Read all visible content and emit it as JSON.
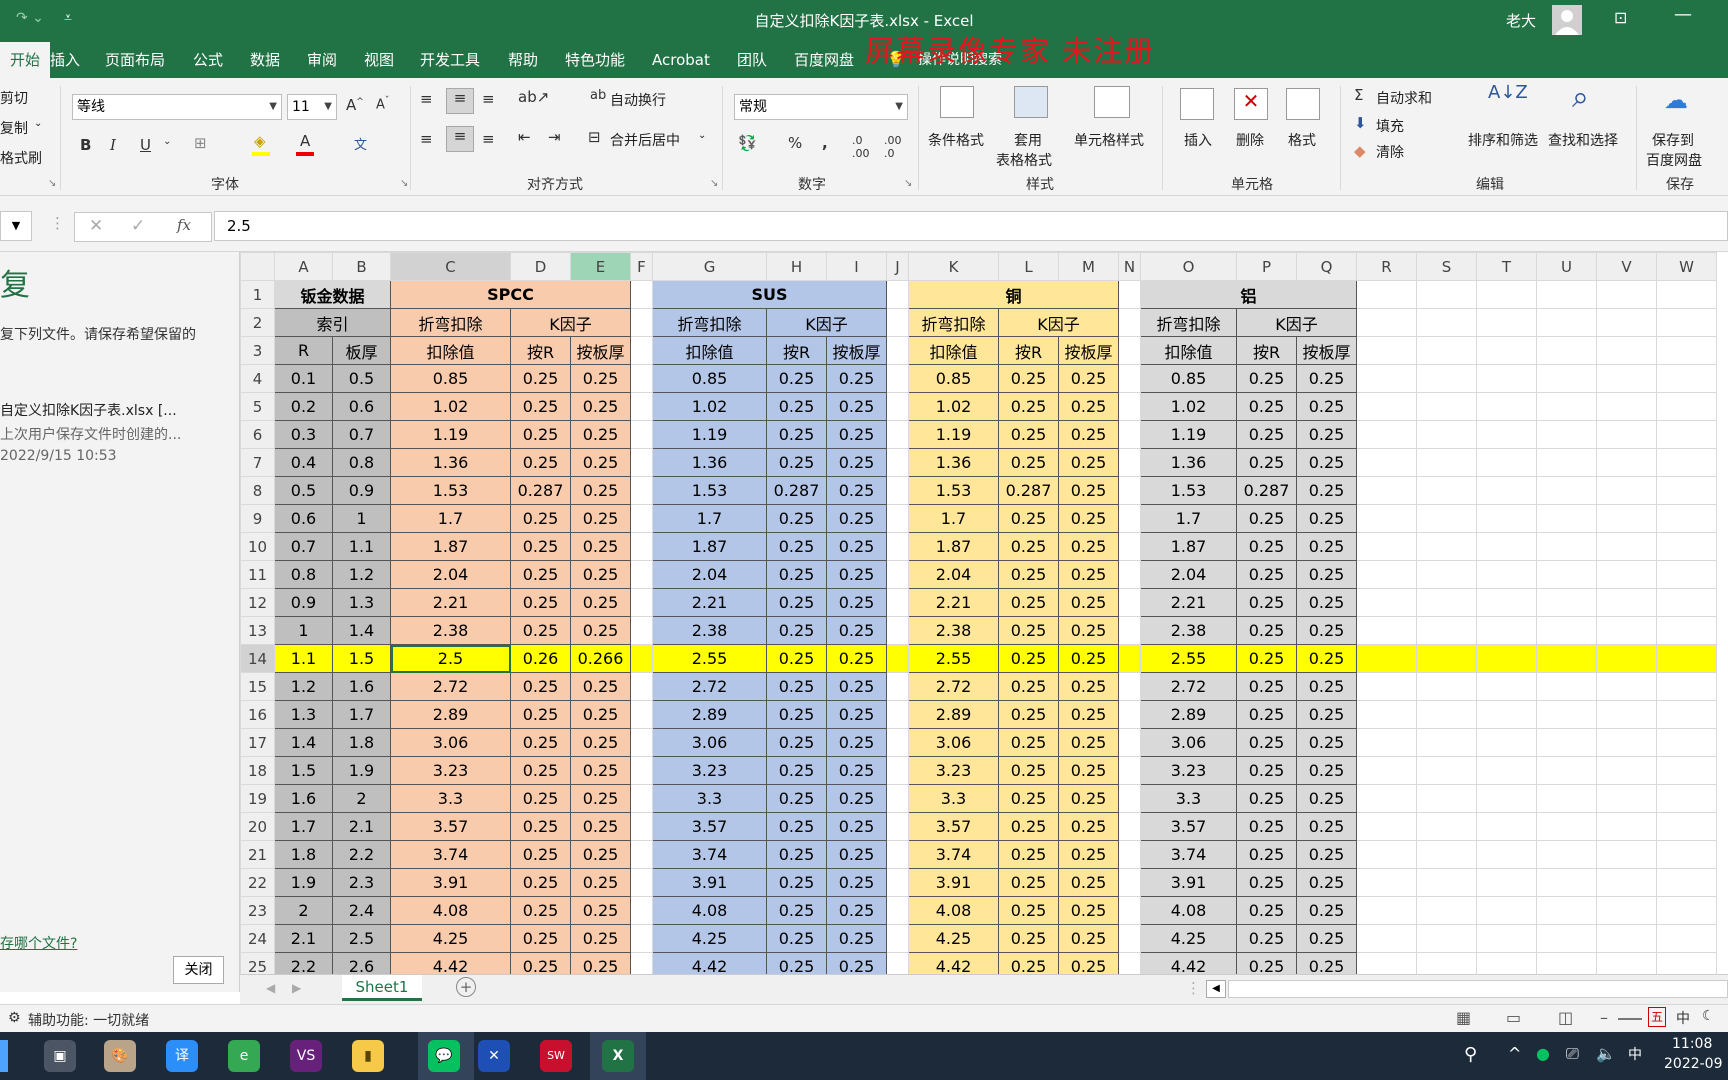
{
  "window": {
    "title": "自定义扣除K因子表.xlsx  -  Excel",
    "user": "老大"
  },
  "watermark": "屏幕录像专家  未注册",
  "menu": {
    "tabs": [
      "开始",
      "插入",
      "页面布局",
      "公式",
      "数据",
      "审阅",
      "视图",
      "开发工具",
      "帮助",
      "特色功能",
      "Acrobat",
      "团队",
      "百度网盘"
    ],
    "search": "操作说明搜索"
  },
  "ribbon": {
    "clipboard": {
      "cut": "剪切",
      "copy": "复制",
      "painter": "格式刷"
    },
    "font": {
      "name": "等线",
      "size": "11",
      "group": "字体"
    },
    "align": {
      "wrap": "自动换行",
      "merge": "合并后居中",
      "group": "对齐方式"
    },
    "number": {
      "format": "常规",
      "group": "数字"
    },
    "styles": {
      "cond": "条件格式",
      "table1": "套用",
      "table2": "表格格式",
      "cell": "单元格样式",
      "group": "样式"
    },
    "cells": {
      "insert": "插入",
      "delete": "删除",
      "format": "格式",
      "group": "单元格"
    },
    "edit": {
      "autosum": "自动求和",
      "fill": "填充",
      "clear": "清除",
      "sort": "排序和筛选",
      "find": "查找和选择",
      "group": "编辑"
    },
    "save": {
      "l1": "保存到",
      "l2": "百度网盘",
      "group": "保存"
    }
  },
  "formula": {
    "fx": "fx",
    "value": "2.5"
  },
  "pane": {
    "title": "复",
    "desc": "复下列文件。请保存希望保留的",
    "file": "自定义扣除K因子表.xlsx  [...",
    "note": "上次用户保存文件时创建的...",
    "date": "2022/9/15 10:53",
    "link": "存哪个文件?",
    "close": "关闭"
  },
  "colors": {
    "excel_green": "#217346",
    "spcc": "#f8cbad",
    "sus": "#b4c6e7",
    "copper": "#ffe699",
    "alu": "#d9d9d9",
    "index": "#bfbfbf",
    "highlight": "#ffff00"
  },
  "sheet": {
    "columns": [
      "A",
      "B",
      "C",
      "D",
      "E",
      "F",
      "G",
      "H",
      "I",
      "J",
      "K",
      "L",
      "M",
      "N",
      "O",
      "P",
      "Q",
      "R",
      "S",
      "T",
      "U",
      "V",
      "W"
    ],
    "headers": {
      "r1": [
        "钣金数据",
        "SPCC",
        "SUS",
        "铜",
        "铝"
      ],
      "r2": [
        "索引",
        "折弯扣除",
        "K因子",
        "折弯扣除",
        "K因子",
        "折弯扣除",
        "K因子",
        "折弯扣除",
        "K因子"
      ],
      "r3": [
        "R",
        "板厚",
        "扣除值",
        "按R",
        "按板厚",
        "扣除值",
        "按R",
        "按板厚",
        "扣除值",
        "按R",
        "按板厚",
        "扣除值",
        "按R",
        "按板厚"
      ]
    },
    "selected_row": 14,
    "rows": [
      {
        "n": 4,
        "r": "0.1",
        "t": "0.5",
        "c": [
          "0.85",
          "0.25",
          "0.25",
          "0.85",
          "0.25",
          "0.25",
          "0.85",
          "0.25",
          "0.25",
          "0.85",
          "0.25",
          "0.25"
        ]
      },
      {
        "n": 5,
        "r": "0.2",
        "t": "0.6",
        "c": [
          "1.02",
          "0.25",
          "0.25",
          "1.02",
          "0.25",
          "0.25",
          "1.02",
          "0.25",
          "0.25",
          "1.02",
          "0.25",
          "0.25"
        ]
      },
      {
        "n": 6,
        "r": "0.3",
        "t": "0.7",
        "c": [
          "1.19",
          "0.25",
          "0.25",
          "1.19",
          "0.25",
          "0.25",
          "1.19",
          "0.25",
          "0.25",
          "1.19",
          "0.25",
          "0.25"
        ]
      },
      {
        "n": 7,
        "r": "0.4",
        "t": "0.8",
        "c": [
          "1.36",
          "0.25",
          "0.25",
          "1.36",
          "0.25",
          "0.25",
          "1.36",
          "0.25",
          "0.25",
          "1.36",
          "0.25",
          "0.25"
        ]
      },
      {
        "n": 8,
        "r": "0.5",
        "t": "0.9",
        "c": [
          "1.53",
          "0.287",
          "0.25",
          "1.53",
          "0.287",
          "0.25",
          "1.53",
          "0.287",
          "0.25",
          "1.53",
          "0.287",
          "0.25"
        ]
      },
      {
        "n": 9,
        "r": "0.6",
        "t": "1",
        "c": [
          "1.7",
          "0.25",
          "0.25",
          "1.7",
          "0.25",
          "0.25",
          "1.7",
          "0.25",
          "0.25",
          "1.7",
          "0.25",
          "0.25"
        ]
      },
      {
        "n": 10,
        "r": "0.7",
        "t": "1.1",
        "c": [
          "1.87",
          "0.25",
          "0.25",
          "1.87",
          "0.25",
          "0.25",
          "1.87",
          "0.25",
          "0.25",
          "1.87",
          "0.25",
          "0.25"
        ]
      },
      {
        "n": 11,
        "r": "0.8",
        "t": "1.2",
        "c": [
          "2.04",
          "0.25",
          "0.25",
          "2.04",
          "0.25",
          "0.25",
          "2.04",
          "0.25",
          "0.25",
          "2.04",
          "0.25",
          "0.25"
        ]
      },
      {
        "n": 12,
        "r": "0.9",
        "t": "1.3",
        "c": [
          "2.21",
          "0.25",
          "0.25",
          "2.21",
          "0.25",
          "0.25",
          "2.21",
          "0.25",
          "0.25",
          "2.21",
          "0.25",
          "0.25"
        ]
      },
      {
        "n": 13,
        "r": "1",
        "t": "1.4",
        "c": [
          "2.38",
          "0.25",
          "0.25",
          "2.38",
          "0.25",
          "0.25",
          "2.38",
          "0.25",
          "0.25",
          "2.38",
          "0.25",
          "0.25"
        ]
      },
      {
        "n": 14,
        "r": "1.1",
        "t": "1.5",
        "c": [
          "2.5",
          "0.26",
          "0.266",
          "2.55",
          "0.25",
          "0.25",
          "2.55",
          "0.25",
          "0.25",
          "2.55",
          "0.25",
          "0.25"
        ]
      },
      {
        "n": 15,
        "r": "1.2",
        "t": "1.6",
        "c": [
          "2.72",
          "0.25",
          "0.25",
          "2.72",
          "0.25",
          "0.25",
          "2.72",
          "0.25",
          "0.25",
          "2.72",
          "0.25",
          "0.25"
        ]
      },
      {
        "n": 16,
        "r": "1.3",
        "t": "1.7",
        "c": [
          "2.89",
          "0.25",
          "0.25",
          "2.89",
          "0.25",
          "0.25",
          "2.89",
          "0.25",
          "0.25",
          "2.89",
          "0.25",
          "0.25"
        ]
      },
      {
        "n": 17,
        "r": "1.4",
        "t": "1.8",
        "c": [
          "3.06",
          "0.25",
          "0.25",
          "3.06",
          "0.25",
          "0.25",
          "3.06",
          "0.25",
          "0.25",
          "3.06",
          "0.25",
          "0.25"
        ]
      },
      {
        "n": 18,
        "r": "1.5",
        "t": "1.9",
        "c": [
          "3.23",
          "0.25",
          "0.25",
          "3.23",
          "0.25",
          "0.25",
          "3.23",
          "0.25",
          "0.25",
          "3.23",
          "0.25",
          "0.25"
        ]
      },
      {
        "n": 19,
        "r": "1.6",
        "t": "2",
        "c": [
          "3.3",
          "0.25",
          "0.25",
          "3.3",
          "0.25",
          "0.25",
          "3.3",
          "0.25",
          "0.25",
          "3.3",
          "0.25",
          "0.25"
        ]
      },
      {
        "n": 20,
        "r": "1.7",
        "t": "2.1",
        "c": [
          "3.57",
          "0.25",
          "0.25",
          "3.57",
          "0.25",
          "0.25",
          "3.57",
          "0.25",
          "0.25",
          "3.57",
          "0.25",
          "0.25"
        ]
      },
      {
        "n": 21,
        "r": "1.8",
        "t": "2.2",
        "c": [
          "3.74",
          "0.25",
          "0.25",
          "3.74",
          "0.25",
          "0.25",
          "3.74",
          "0.25",
          "0.25",
          "3.74",
          "0.25",
          "0.25"
        ]
      },
      {
        "n": 22,
        "r": "1.9",
        "t": "2.3",
        "c": [
          "3.91",
          "0.25",
          "0.25",
          "3.91",
          "0.25",
          "0.25",
          "3.91",
          "0.25",
          "0.25",
          "3.91",
          "0.25",
          "0.25"
        ]
      },
      {
        "n": 23,
        "r": "2",
        "t": "2.4",
        "c": [
          "4.08",
          "0.25",
          "0.25",
          "4.08",
          "0.25",
          "0.25",
          "4.08",
          "0.25",
          "0.25",
          "4.08",
          "0.25",
          "0.25"
        ]
      },
      {
        "n": 24,
        "r": "2.1",
        "t": "2.5",
        "c": [
          "4.25",
          "0.25",
          "0.25",
          "4.25",
          "0.25",
          "0.25",
          "4.25",
          "0.25",
          "0.25",
          "4.25",
          "0.25",
          "0.25"
        ]
      },
      {
        "n": 25,
        "r": "2.2",
        "t": "2.6",
        "c": [
          "4.42",
          "0.25",
          "0.25",
          "4.42",
          "0.25",
          "0.25",
          "4.42",
          "0.25",
          "0.25",
          "4.42",
          "0.25",
          "0.25"
        ]
      }
    ]
  },
  "sheetTab": "Sheet1",
  "status": {
    "text": "辅助功能: 一切就绪",
    "ime": "中"
  },
  "taskbar": {
    "time": "11:08",
    "date": "2022-09"
  }
}
